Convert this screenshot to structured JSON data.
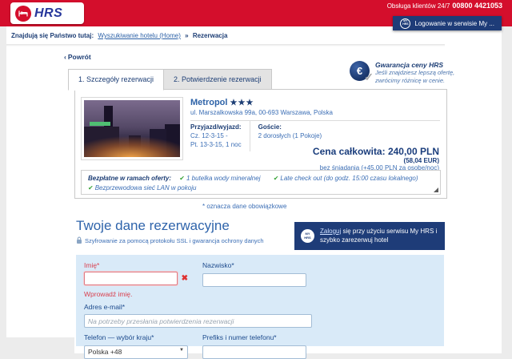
{
  "header": {
    "logo_text": "HRS",
    "support_label": "Obsługa klientów 24/7",
    "support_phone": "00800 4421053",
    "login_button": "Logowanie w serwisie My ..."
  },
  "icons": {
    "myhrs_top": "MY",
    "myhrs_bottom": "HRS",
    "euro": "€",
    "euro_check": "✓",
    "check": "✔",
    "error_x": "✖",
    "dropdown_arrow": "▼",
    "chevron_left": "‹"
  },
  "breadcrumb": {
    "prefix": "Znajdują się Państwo tutaj:",
    "link": "Wyszukiwanie hotelu (Home)",
    "separator": "»",
    "current": "Rezerwacja"
  },
  "back_link": {
    "label": "Powrót"
  },
  "tabs": [
    {
      "label": "1. Szczegóły rezerwacji"
    },
    {
      "label": "2. Potwierdzenie rezerwacji"
    }
  ],
  "price_guarantee": {
    "title": "Gwarancja ceny HRS",
    "line1": "Jeśli znajdziesz lepszą ofertę,",
    "line2": "zwrócimy różnicę w cenie."
  },
  "hotel": {
    "name": "Metropol",
    "stars": "★★★",
    "address": "ul. Marszalkowska 99a, 00-693 Warszawa, Polska",
    "checkin_label": "Przyjazd/wyjazd:",
    "checkin_line1": "Cz. 12-3-15 -",
    "checkin_line2": "Pt. 13-3-15, 1 noc",
    "guests_label": "Goście:",
    "guests_value": "2 dorosłych (1 Pokoje)",
    "total_label": "Cena całkowita:",
    "total_price": "240,00 PLN",
    "total_eur": "(58,04 EUR)",
    "breakfast_note": "bez śniadania (+45,00 PLN za osobę/noc)"
  },
  "free_offers": {
    "title": "Bezpłatne w ramach oferty:",
    "items": [
      "1 butelka wody mineralnej",
      "Late check out (do godz. 15:00 czasu lokalnego)",
      "Bezprzewodowa sieć LAN w pokoju"
    ]
  },
  "required_note": "* oznacza dane obowiązkowe",
  "form": {
    "title": "Twoje dane rezerwacyjne",
    "ssl_note": "Szyfrowanie za pomocą protokołu SSL i gwarancja ochrony danych",
    "promo_link": "Zaloguj",
    "promo_text": " się przy użyciu serwisu My HRS i szybko zarezerwuj hotel",
    "fields": {
      "first_name": {
        "label": "Imię*",
        "value": "",
        "error": "Wprowadź imię."
      },
      "last_name": {
        "label": "Nazwisko*",
        "value": ""
      },
      "email": {
        "label": "Adres e-mail*",
        "value": "",
        "placeholder": "Na potrzeby przesłania potwierdzenia rezerwacji"
      },
      "phone_country": {
        "label": "Telefon — wybór kraju*",
        "value": "Polska +48"
      },
      "phone_number": {
        "label": "Prefiks i numer telefonu*",
        "value": ""
      }
    }
  }
}
